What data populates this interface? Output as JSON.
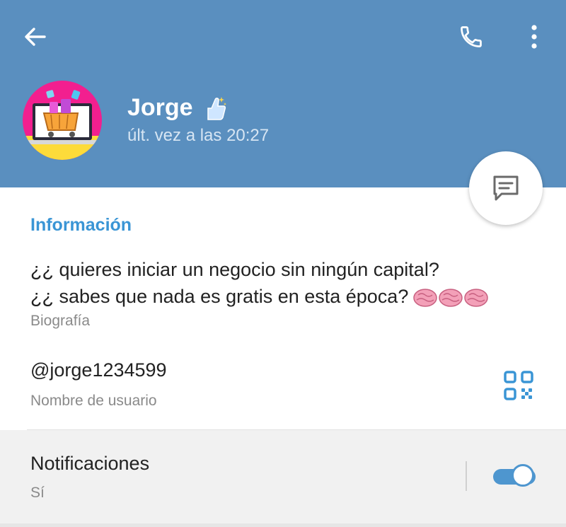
{
  "header": {
    "back_icon": "arrow-left-icon",
    "call_icon": "phone-icon",
    "menu_icon": "more-vertical-icon",
    "name": "Jorge",
    "name_emoji": "thumbs-up-sparkles-emoji",
    "status": "últ. vez a las 20:27",
    "avatar": "shopping-cart-laptop-avatar",
    "colors": {
      "background": "#5a8fbf"
    }
  },
  "fab": {
    "icon": "message-icon"
  },
  "info": {
    "title": "Información",
    "bio_line1": "¿¿ quieres iniciar un negocio sin ningún capital?",
    "bio_line2": "¿¿ sabes que nada es gratis en esta época?",
    "bio_emoji": "brain-emoji-x3",
    "bio_label": "Biografía",
    "username": "@jorge1234599",
    "username_label": "Nombre de usuario",
    "qr_icon": "qr-code-icon"
  },
  "notifications": {
    "title": "Notificaciones",
    "value": "Sí",
    "enabled": true,
    "accent": "#4e96cf"
  }
}
